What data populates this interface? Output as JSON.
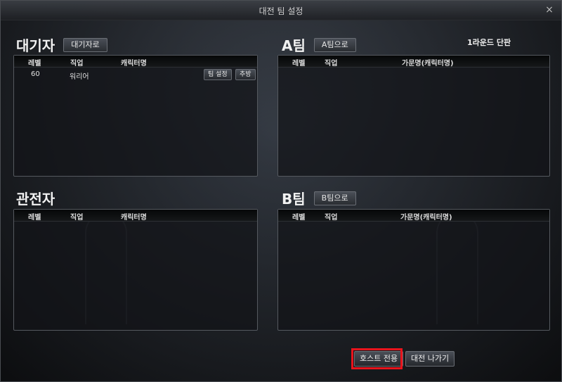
{
  "window": {
    "title": "대전 팀 설정",
    "close_glyph": "×"
  },
  "waiting": {
    "title": "대기자",
    "button_label": "대기자로",
    "columns": [
      "레벨",
      "직업",
      "캐릭터명"
    ],
    "rows": [
      {
        "level": "60",
        "class": "워리어",
        "name": "",
        "team_btn": "팀 설정",
        "kick_btn": "추방"
      }
    ]
  },
  "team_a": {
    "title": "A팀",
    "button_label": "A팀으로",
    "round_info": "1라운드 단판",
    "columns": [
      "레벨",
      "직업",
      "가문명(캐릭터명)"
    ]
  },
  "spectators": {
    "title": "관전자",
    "columns": [
      "레벨",
      "직업",
      "캐릭터명"
    ]
  },
  "team_b": {
    "title": "B팀",
    "button_label": "B팀으로",
    "columns": [
      "레벨",
      "직업",
      "가문명(캐릭터명)"
    ]
  },
  "footer": {
    "host_only_label": "호스트 전용",
    "leave_label": "대전 나가기"
  },
  "colors": {
    "highlight": "#e8141c",
    "panel_border": "#55595f"
  }
}
